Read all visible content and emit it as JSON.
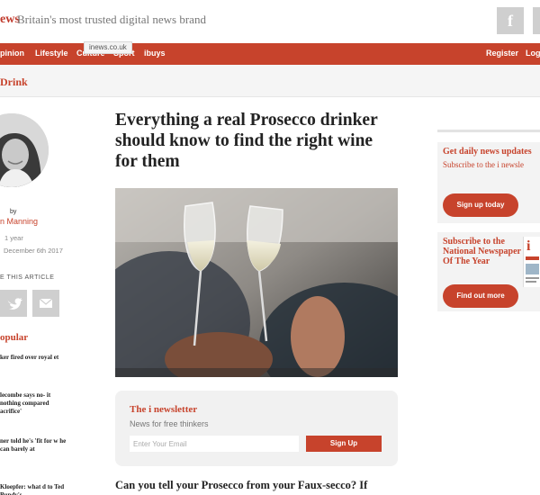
{
  "header": {
    "logo_fragment": "ews",
    "tagline": "Britain's most trusted digital news brand",
    "social": [
      {
        "icon": "facebook-icon",
        "glyph": "f"
      }
    ]
  },
  "nav": {
    "items": [
      "pinion",
      "Lifestyle",
      "Culture",
      "Sport",
      "ibuys"
    ],
    "right": [
      "Register",
      "Log"
    ],
    "tooltip": "inews.co.uk"
  },
  "section": {
    "label": "Drink"
  },
  "author": {
    "by": "by",
    "name": "n Manning",
    "age": "1 year",
    "date": "December 6th 2017",
    "share_label": "E THIS ARTICLE",
    "share_buttons": [
      "twitter-icon",
      "email-icon"
    ]
  },
  "popular": {
    "title": "opular",
    "items": [
      "ker fired over royal et",
      "lecombe says no- it nothing compared acrifice'",
      "ner told he's 'fit for w he can barely at",
      "Kloepfer: what d to Ted Bundy's"
    ]
  },
  "article": {
    "headline": "Everything a real Prosecco drinker should know to find the right wine for them",
    "lede": "Can you tell your Prosecco from your Faux-secco? If"
  },
  "newsletter": {
    "title": "The i newsletter",
    "subtitle": "News for free thinkers",
    "placeholder": "Enter Your Email",
    "button": "Sign Up"
  },
  "sidebar": {
    "card1": {
      "title": "Get daily news updates",
      "subtitle": "Subscribe to the i newsle",
      "button": "Sign up today"
    },
    "card2": {
      "title": "Subscribe to the National Newspaper Of The Year",
      "button": "Find out more"
    }
  },
  "colors": {
    "brand_red": "#c7432c",
    "light_gray": "#f3f3f3"
  }
}
